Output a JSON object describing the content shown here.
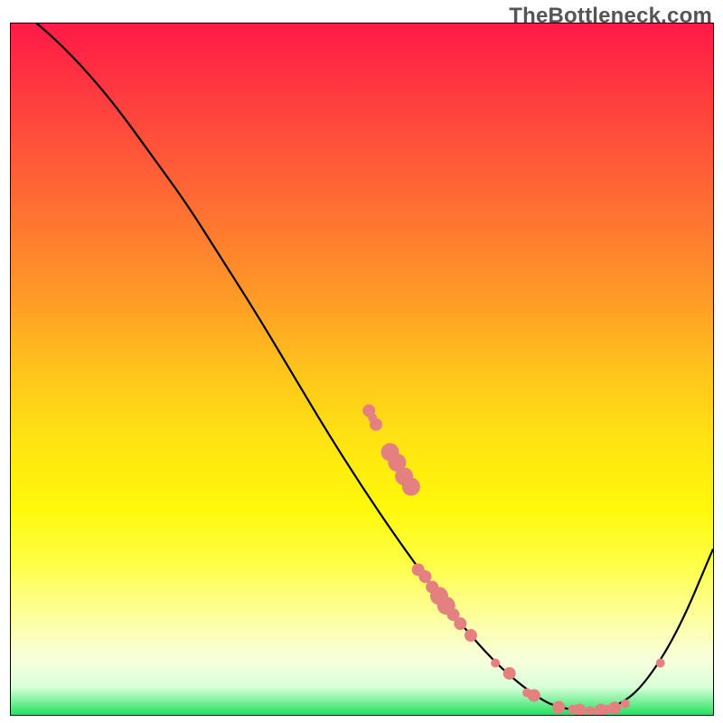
{
  "watermark": "TheBottleneck.com",
  "chart_data": {
    "type": "line",
    "title": "",
    "xlabel": "",
    "ylabel": "",
    "x_range": [
      0,
      100
    ],
    "y_range": [
      0,
      100
    ],
    "curve": [
      {
        "x": 0,
        "y": 103
      },
      {
        "x": 5,
        "y": 99
      },
      {
        "x": 10,
        "y": 94
      },
      {
        "x": 15,
        "y": 88
      },
      {
        "x": 20,
        "y": 81
      },
      {
        "x": 25,
        "y": 74
      },
      {
        "x": 30,
        "y": 66
      },
      {
        "x": 35,
        "y": 58
      },
      {
        "x": 40,
        "y": 49.5
      },
      {
        "x": 45,
        "y": 41
      },
      {
        "x": 50,
        "y": 33
      },
      {
        "x": 55,
        "y": 25.5
      },
      {
        "x": 60,
        "y": 18.5
      },
      {
        "x": 65,
        "y": 12
      },
      {
        "x": 70,
        "y": 6.5
      },
      {
        "x": 75,
        "y": 2.5
      },
      {
        "x": 78,
        "y": 1.0
      },
      {
        "x": 82,
        "y": 0.6
      },
      {
        "x": 86,
        "y": 1.0
      },
      {
        "x": 90,
        "y": 4
      },
      {
        "x": 95,
        "y": 12
      },
      {
        "x": 100,
        "y": 24
      }
    ],
    "points_small": [
      {
        "x": 51.5,
        "y": 43
      },
      {
        "x": 69.0,
        "y": 7.5
      },
      {
        "x": 73.5,
        "y": 3.2
      },
      {
        "x": 80.0,
        "y": 0.8
      },
      {
        "x": 82.5,
        "y": 0.6
      },
      {
        "x": 85.0,
        "y": 0.8
      },
      {
        "x": 87.5,
        "y": 1.6
      },
      {
        "x": 92.5,
        "y": 7.5
      }
    ],
    "points_medium": [
      {
        "x": 51.0,
        "y": 44
      },
      {
        "x": 52.0,
        "y": 42
      },
      {
        "x": 58.0,
        "y": 21
      },
      {
        "x": 59.0,
        "y": 20
      },
      {
        "x": 60.0,
        "y": 18.5
      },
      {
        "x": 63.0,
        "y": 14.5
      },
      {
        "x": 64.0,
        "y": 13.2
      },
      {
        "x": 65.5,
        "y": 11.5
      },
      {
        "x": 71.0,
        "y": 6.0
      },
      {
        "x": 74.5,
        "y": 2.8
      },
      {
        "x": 78.0,
        "y": 1.1
      },
      {
        "x": 81.0,
        "y": 0.7
      },
      {
        "x": 84.0,
        "y": 0.7
      },
      {
        "x": 86.0,
        "y": 1.0
      }
    ],
    "points_large": [
      {
        "x": 54.0,
        "y": 38
      },
      {
        "x": 55.0,
        "y": 36.5
      },
      {
        "x": 56.0,
        "y": 34.5
      },
      {
        "x": 57.0,
        "y": 33
      },
      {
        "x": 61.0,
        "y": 17.2
      },
      {
        "x": 62.0,
        "y": 15.8
      }
    ],
    "point_color": "#e58080",
    "curve_color": "#000000"
  }
}
